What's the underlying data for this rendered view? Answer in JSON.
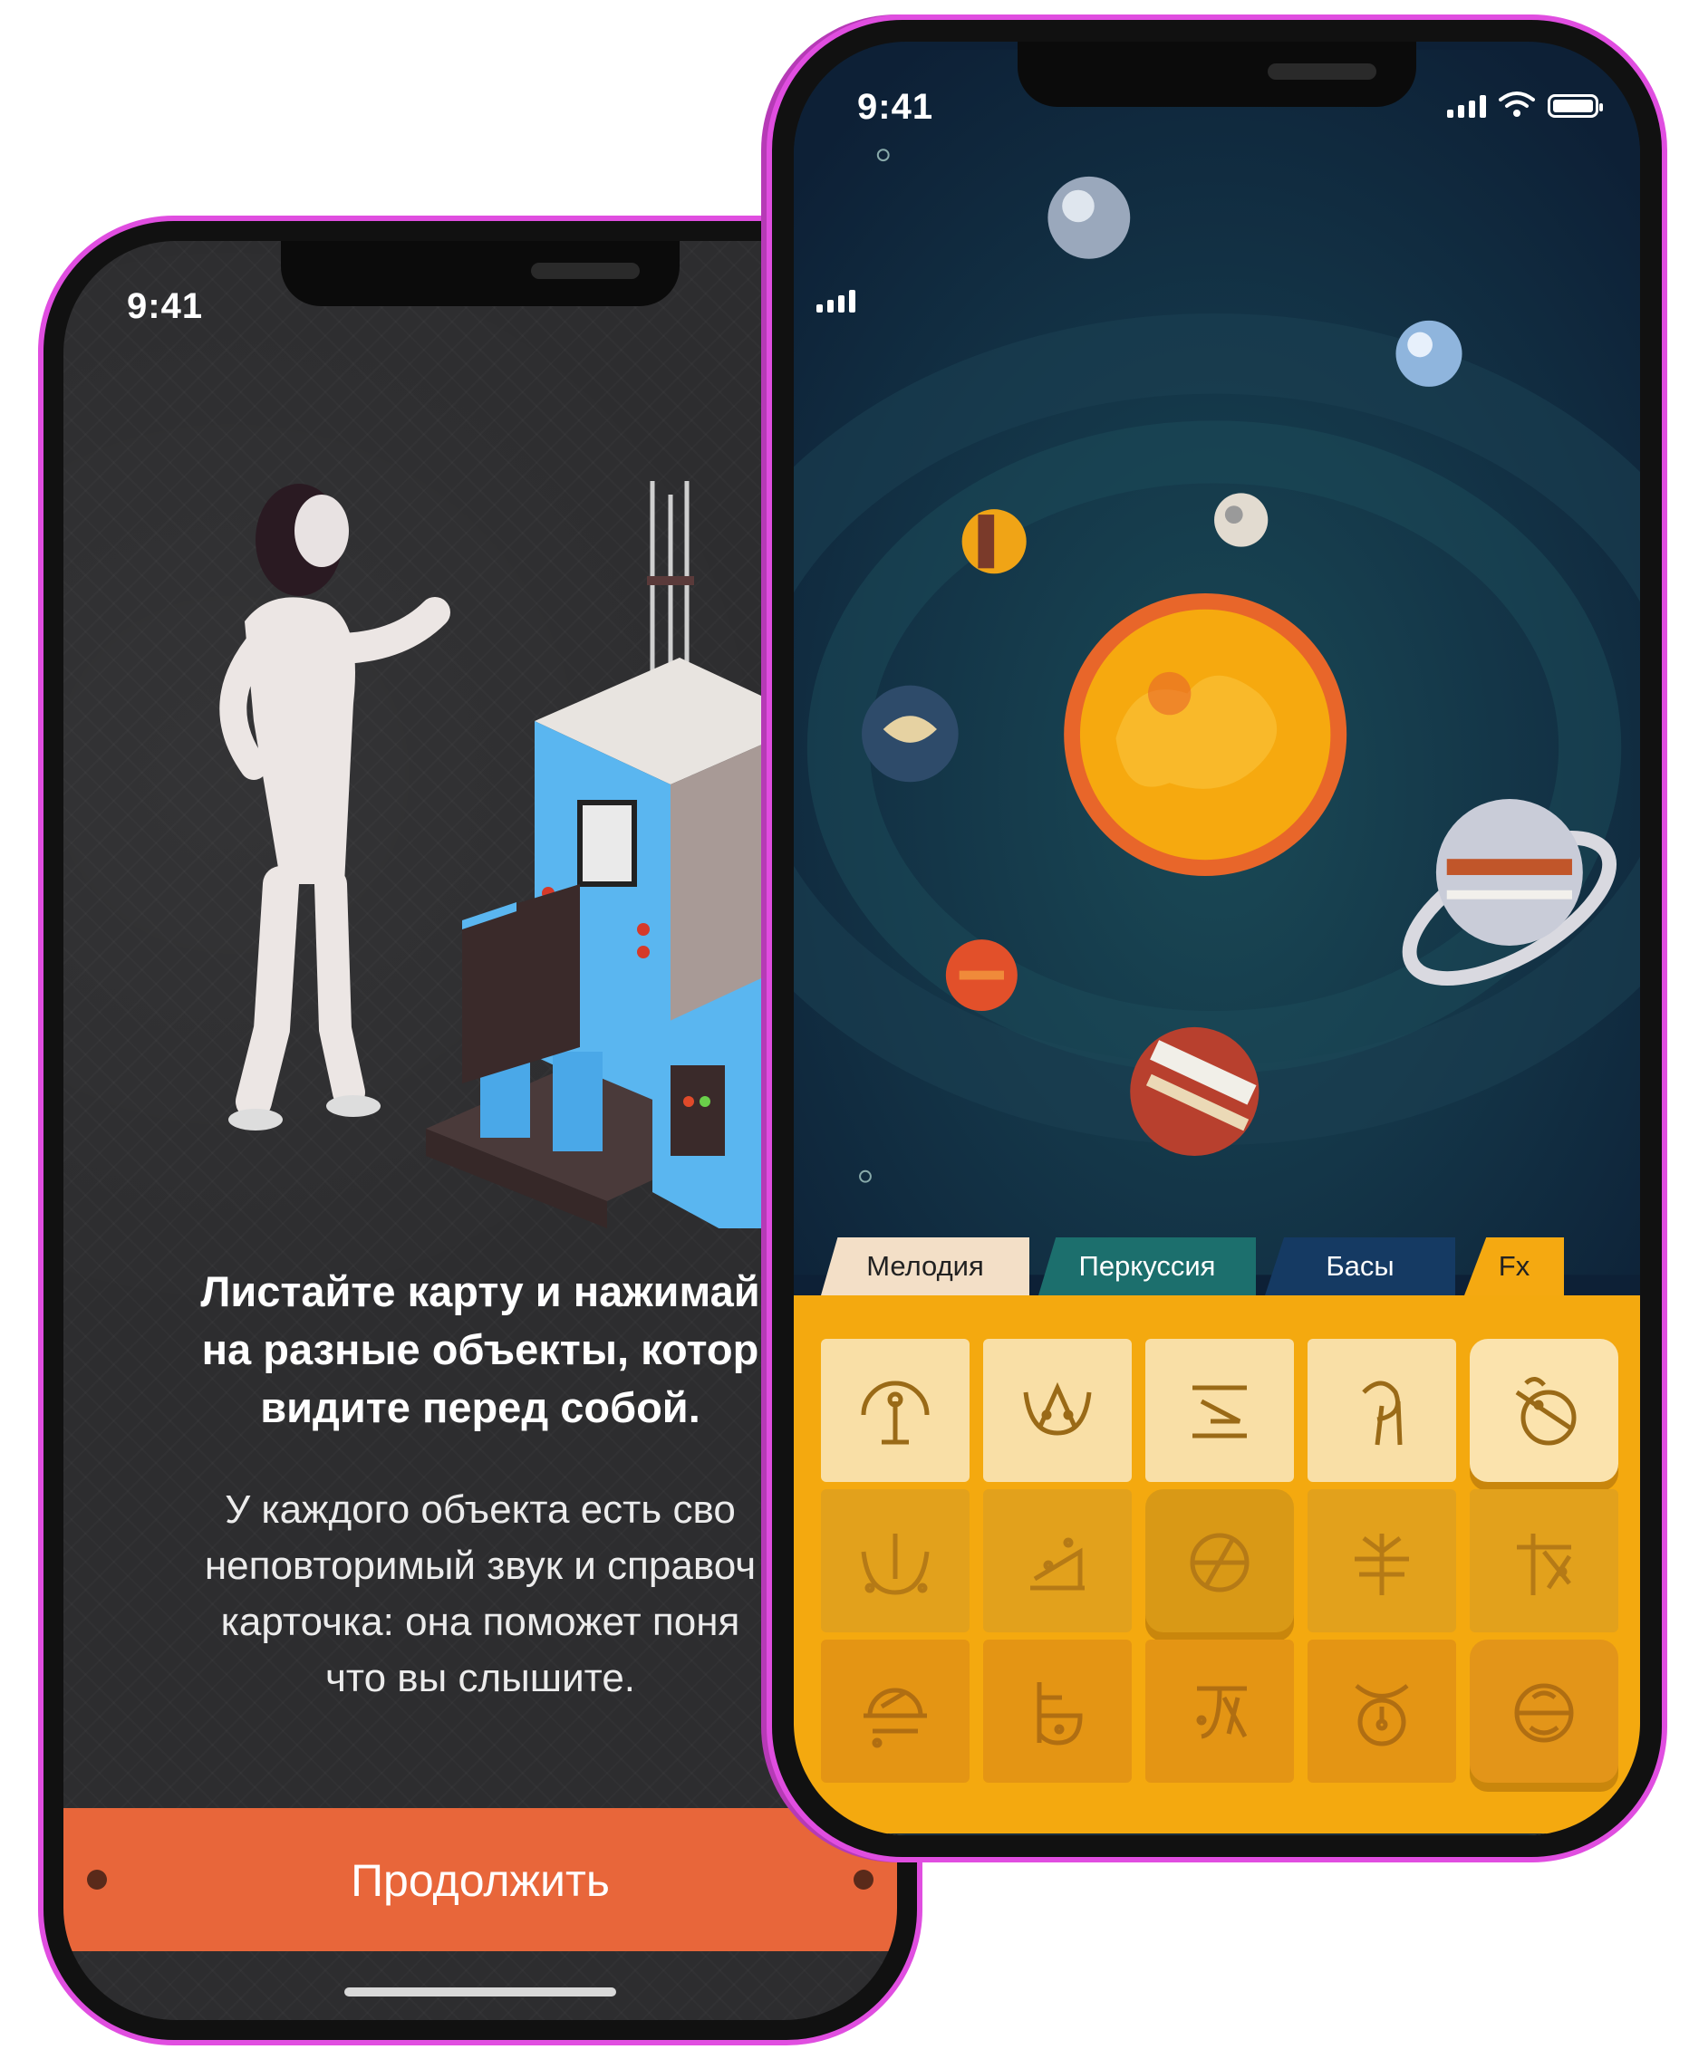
{
  "left_screen": {
    "status_time": "9:41",
    "title": "Листайте карту и нажимай на разные объекты, котор видите перед собой.",
    "title_lines": [
      "Листайте карту и нажимай",
      "на разные объекты, котор",
      "видите перед собой."
    ],
    "body_lines": [
      "У каждого объекта есть сво",
      "неповторимый звук и справоч",
      "карточка: она поможет поня",
      "что вы слышите."
    ],
    "continue_label": "Продолжить",
    "accent_color": "#e8663a"
  },
  "right_screen": {
    "status_time": "9:41",
    "tabs": [
      {
        "label": "Мелодия",
        "color": "#f3dfc7"
      },
      {
        "label": "Перкуссия",
        "color": "#1c6f6d"
      },
      {
        "label": "Басы",
        "color": "#153a63"
      },
      {
        "label": "Fx",
        "color": "#f5a911",
        "active": true
      }
    ],
    "pads": [
      {
        "icon": "glyph-pad-icon-1",
        "pressed": false
      },
      {
        "icon": "glyph-pad-icon-2",
        "pressed": false
      },
      {
        "icon": "glyph-pad-icon-3",
        "pressed": false
      },
      {
        "icon": "glyph-pad-icon-4",
        "pressed": false
      },
      {
        "icon": "glyph-pad-icon-5",
        "pressed": true
      },
      {
        "icon": "glyph-pad-icon-6",
        "pressed": false
      },
      {
        "icon": "glyph-pad-icon-7",
        "pressed": false
      },
      {
        "icon": "glyph-pad-icon-8",
        "pressed": true
      },
      {
        "icon": "glyph-pad-icon-9",
        "pressed": false
      },
      {
        "icon": "glyph-pad-icon-10",
        "pressed": false
      },
      {
        "icon": "glyph-pad-icon-11",
        "pressed": false
      },
      {
        "icon": "glyph-pad-icon-12",
        "pressed": false
      },
      {
        "icon": "glyph-pad-icon-13",
        "pressed": false
      },
      {
        "icon": "glyph-pad-icon-14",
        "pressed": false
      },
      {
        "icon": "glyph-pad-icon-15",
        "pressed": true
      }
    ],
    "panel_color": "#f4a90f"
  },
  "frame_color": "#e04ee0"
}
